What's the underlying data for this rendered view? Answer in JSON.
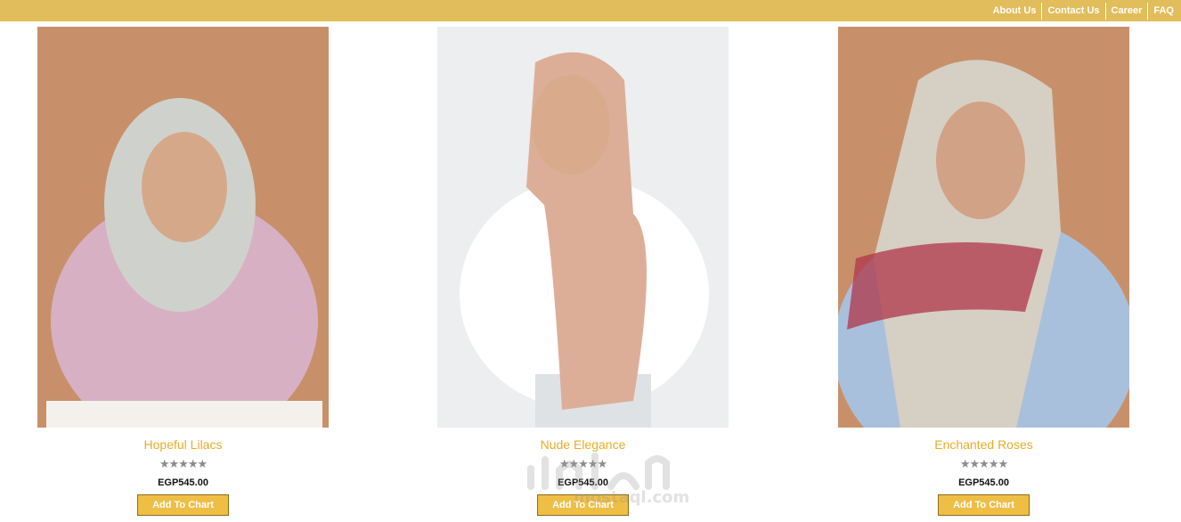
{
  "nav": {
    "links": [
      "About Us",
      "Contact Us",
      "Career",
      "FAQ"
    ]
  },
  "products": [
    {
      "name": "Hopeful Lilacs",
      "rating": "★★★★★",
      "price": "EGP545.00",
      "button": "Add To Chart",
      "backdrop": "#c8906a",
      "hijab": "#cfd2cc",
      "top": "#d8b0c4"
    },
    {
      "name": "Nude Elegance",
      "rating": "★★★★★",
      "price": "EGP545.00",
      "button": "Add To Chart",
      "backdrop": "#eceef0",
      "hijab": "#dcae98",
      "top": "#ffffff"
    },
    {
      "name": "Enchanted Roses",
      "rating": "★★★★★",
      "price": "EGP545.00",
      "button": "Add To Chart",
      "backdrop": "#c8906a",
      "hijab": "#d6cfc4",
      "top": "#a9c0dc"
    }
  ],
  "watermark": {
    "text": "mostaql.com"
  },
  "colors": {
    "topbar": "#e2bd5c",
    "product_name": "#e9ac27",
    "button": "#efbe45",
    "stars": "#8c8c8c"
  }
}
